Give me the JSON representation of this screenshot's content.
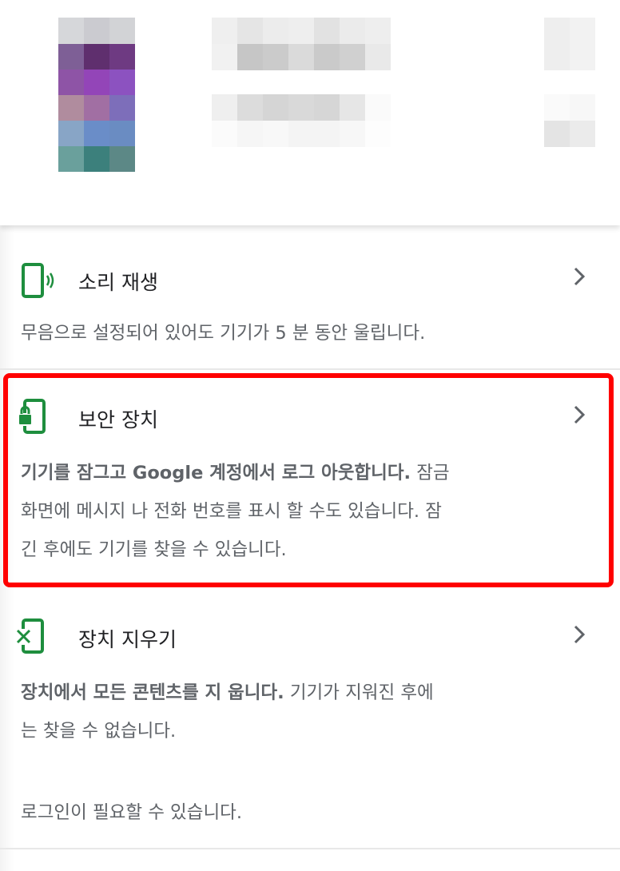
{
  "actions": [
    {
      "title": "소리 재생",
      "icon": "phone-ring-icon",
      "desc_bold": "",
      "desc": "무음으로 설정되어 있어도 기기가 5 분 동안 울립니다."
    },
    {
      "title": "보안 장치",
      "icon": "phone-lock-icon",
      "desc_bold": "기기를 잠그고 Google 계정에서 로그 아웃합니다.",
      "desc_line1_rest": " 잠금",
      "desc_line2": "화면에 메시지 나 전화 번호를 표시 할 수도 있습니다. 잠",
      "desc_line3": "긴 후에도 기기를 찾을 수 있습니다."
    },
    {
      "title": "장치 지우기",
      "icon": "phone-erase-icon",
      "desc_bold": "장치에서 모든 콘텐츠를 지 웁니다.",
      "desc_line1_rest": " 기기가 지워진 후에",
      "desc_line2": "는 찾을 수 없습니다.",
      "desc_line3": "로그인이 필요할 수 있습니다."
    }
  ],
  "colors": {
    "icon_green": "#1e8e3e",
    "highlight": "#ff0000",
    "text_primary": "#202124",
    "text_secondary": "#5f6368"
  }
}
